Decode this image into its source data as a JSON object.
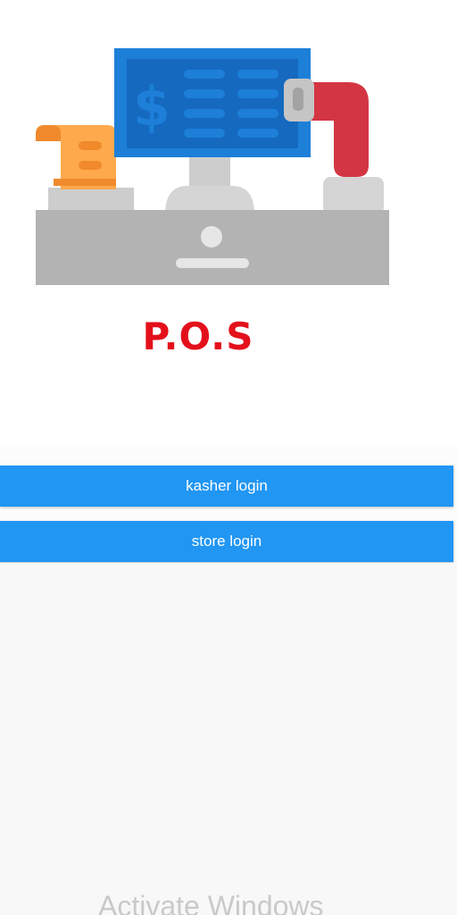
{
  "app": {
    "title": "P.O.S",
    "illustration_icon": "cash-register-icon"
  },
  "buttons": {
    "kasher_login": "kasher login",
    "store_login": "store login"
  },
  "overlay": {
    "watermark": "Activate Windows"
  },
  "colors": {
    "title": "#e3101b",
    "button": "#2196f3",
    "button_text": "#ffffff"
  }
}
